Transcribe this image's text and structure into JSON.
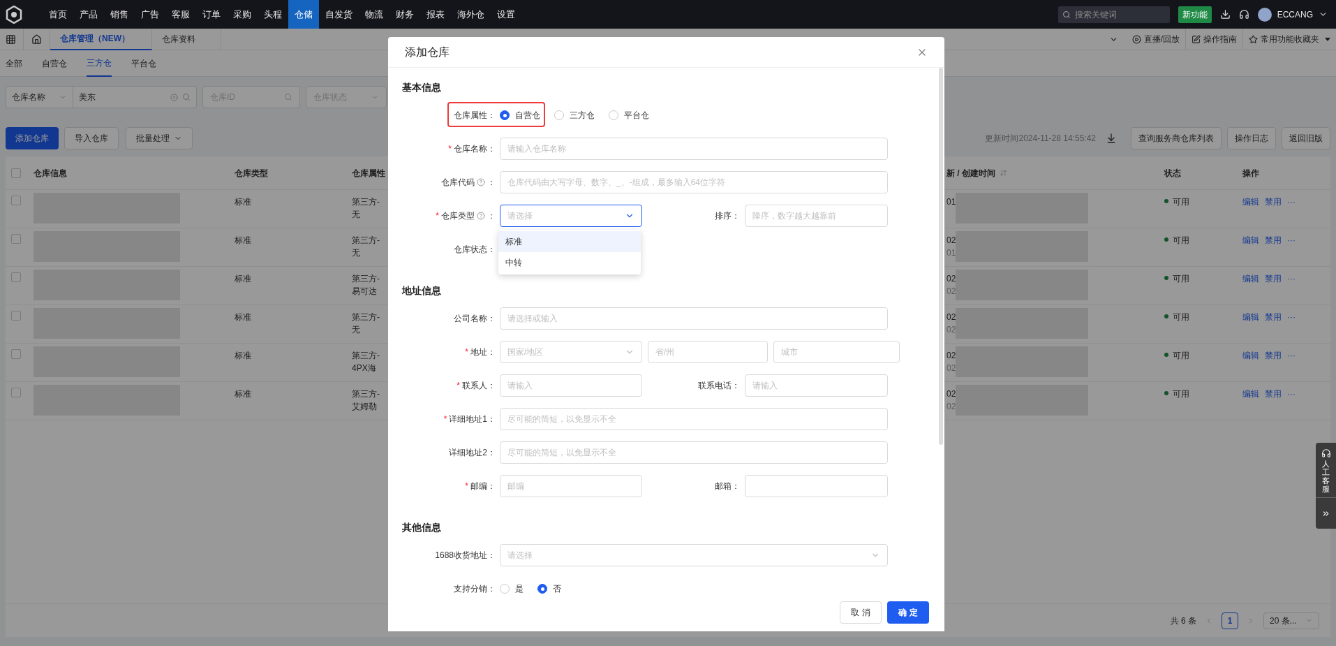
{
  "top_nav": {
    "items": [
      {
        "label": "首页",
        "selected": false
      },
      {
        "label": "产品",
        "selected": false
      },
      {
        "label": "销售",
        "selected": false
      },
      {
        "label": "广告",
        "selected": false
      },
      {
        "label": "客服",
        "selected": false
      },
      {
        "label": "订单",
        "selected": false
      },
      {
        "label": "采购",
        "selected": false
      },
      {
        "label": "头程",
        "selected": false
      },
      {
        "label": "仓储",
        "selected": true
      },
      {
        "label": "自发货",
        "selected": false
      },
      {
        "label": "物流",
        "selected": false
      },
      {
        "label": "财务",
        "selected": false
      },
      {
        "label": "报表",
        "selected": false
      },
      {
        "label": "海外仓",
        "selected": false
      },
      {
        "label": "设置",
        "selected": false
      }
    ],
    "search": {
      "placeholder": "搜索关键词"
    },
    "new_feature_button": "新功能",
    "user": "ECCANG"
  },
  "tab_bar": {
    "tabs": [
      {
        "label": "仓库管理（NEW）",
        "selected": true
      },
      {
        "label": "仓库资料",
        "selected": false
      }
    ],
    "links": [
      "直播/回放",
      "操作指南",
      "常用功能收藏夹"
    ]
  },
  "sub_tabs": [
    {
      "label": "全部",
      "selected": false
    },
    {
      "label": "自营仓",
      "selected": false
    },
    {
      "label": "三方仓",
      "selected": true
    },
    {
      "label": "平台仓",
      "selected": false
    }
  ],
  "filters": {
    "field_select": "仓库名称",
    "keyword": "美东",
    "id_placeholder": "仓库ID",
    "status_placeholder": "仓库状态"
  },
  "actions": {
    "primary": "添加仓库",
    "import": "导入仓库",
    "batch": "批量处理",
    "updated": "更新时间2024-11-28 14:55:42",
    "right_buttons": [
      "查询服务商仓库列表",
      "操作日志",
      "返回旧版"
    ]
  },
  "table": {
    "all_checked": false,
    "columns": [
      "仓库信息",
      "仓库类型",
      "仓库属性",
      "新 / 创建时间",
      "状态",
      "操作"
    ],
    "rows": [
      {
        "checked": false,
        "type": "标准",
        "attribute": [
          "第三方-",
          "无"
        ],
        "time": [
          "01"
        ],
        "status": "可用",
        "actions": [
          "编辑",
          "禁用",
          "···"
        ]
      },
      {
        "checked": false,
        "type": "标准",
        "attribute": [
          "第三方-",
          "无"
        ],
        "time": [
          "02",
          "01"
        ],
        "status": "可用",
        "actions": [
          "编辑",
          "禁用",
          "···"
        ]
      },
      {
        "checked": false,
        "type": "标准",
        "attribute": [
          "第三方-",
          "易可达"
        ],
        "time": [
          "02",
          "02"
        ],
        "status": "可用",
        "actions": [
          "编辑",
          "禁用",
          "···"
        ]
      },
      {
        "checked": false,
        "type": "标准",
        "attribute": [
          "第三方-",
          "无"
        ],
        "time": [
          "02",
          "02"
        ],
        "status": "可用",
        "actions": [
          "编辑",
          "禁用",
          "···"
        ]
      },
      {
        "checked": false,
        "type": "标准",
        "attribute": [
          "第三方-",
          "4PX海"
        ],
        "time": [
          "02",
          "02"
        ],
        "status": "可用",
        "actions": [
          "编辑",
          "禁用",
          "···"
        ]
      },
      {
        "checked": false,
        "type": "标准",
        "attribute": [
          "第三方-",
          "艾姆勒"
        ],
        "time": [
          "02",
          "02"
        ],
        "status": "可用",
        "actions": [
          "编辑",
          "禁用",
          "···"
        ]
      }
    ]
  },
  "pagination": {
    "total": "共 6 条",
    "pages": [
      {
        "label": "1",
        "selected": true
      }
    ],
    "page_size": "20 条..."
  },
  "service_widget": {
    "label": "人工客服"
  },
  "modal": {
    "title": "添加仓库",
    "sections": [
      {
        "title": "基本信息",
        "rows": [
          {
            "fields": [
              {
                "label": "仓库属性：",
                "kind": "radio",
                "highlighted": true,
                "options": [
                  {
                    "label": "自营仓",
                    "selected": true
                  },
                  {
                    "label": "三方仓",
                    "selected": false
                  },
                  {
                    "label": "平台仓",
                    "selected": false
                  }
                ]
              }
            ]
          },
          {
            "fields": [
              {
                "label": "仓库名称：",
                "required_mark": "*",
                "kind": "input",
                "placeholder": "请输入仓库名称"
              }
            ]
          },
          {
            "fields": [
              {
                "label": "仓库代码",
                "help": true,
                "label_suffix": "：",
                "kind": "input",
                "placeholder": "仓库代码由大写字母、数字、_、-组成，最多输入64位字符"
              }
            ]
          },
          {
            "fields": [
              {
                "label": "仓库类型",
                "required_mark": "*",
                "help": true,
                "label_suffix": "：",
                "kind": "select",
                "placeholder": "请选择",
                "expanded": true,
                "menu": [
                  {
                    "label": "标准",
                    "selected": true
                  },
                  {
                    "label": "中转",
                    "selected": false
                  }
                ]
              },
              {
                "label": "排序：",
                "kind": "input",
                "placeholder": "降序，数字越大越靠前"
              }
            ]
          },
          {
            "fields": [
              {
                "label": "仓库状态：",
                "kind": "covered"
              }
            ]
          }
        ]
      },
      {
        "title": "地址信息",
        "rows": [
          {
            "fields": [
              {
                "label": "公司名称：",
                "kind": "input",
                "placeholder": "请选择或输入"
              }
            ]
          },
          {
            "fields": [
              {
                "label": "地址：",
                "required_mark": "*",
                "kind": "address",
                "parts": [
                  {
                    "kind": "select",
                    "placeholder": "国家/地区"
                  },
                  {
                    "kind": "input",
                    "placeholder": "省/州"
                  },
                  {
                    "kind": "input",
                    "placeholder": "城市"
                  }
                ]
              }
            ]
          },
          {
            "fields": [
              {
                "label": "联系人：",
                "required_mark": "*",
                "kind": "input",
                "placeholder": "请输入"
              },
              {
                "label": "联系电话：",
                "kind": "input",
                "placeholder": "请输入"
              }
            ]
          },
          {
            "fields": [
              {
                "label": "详细地址1：",
                "required_mark": "*",
                "kind": "input",
                "placeholder": "尽可能的简短，以免显示不全"
              }
            ]
          },
          {
            "fields": [
              {
                "label": "详细地址2：",
                "kind": "input",
                "placeholder": "尽可能的简短，以免显示不全"
              }
            ]
          },
          {
            "fields": [
              {
                "label": "邮编：",
                "required_mark": "*",
                "kind": "input",
                "placeholder": "邮编"
              },
              {
                "label": "邮箱：",
                "kind": "input"
              }
            ]
          }
        ]
      },
      {
        "title": "其他信息",
        "rows": [
          {
            "fields": [
              {
                "label": "1688收货地址：",
                "kind": "select",
                "placeholder": "请选择"
              }
            ]
          },
          {
            "fields": [
              {
                "label": "支持分销：",
                "kind": "radio",
                "options": [
                  {
                    "label": "是",
                    "selected": false
                  },
                  {
                    "label": "否",
                    "selected": true
                  }
                ]
              }
            ]
          }
        ]
      }
    ],
    "buttons": [
      {
        "label": "取 消",
        "kind": "default"
      },
      {
        "label": "确 定",
        "kind": "primary"
      }
    ]
  }
}
